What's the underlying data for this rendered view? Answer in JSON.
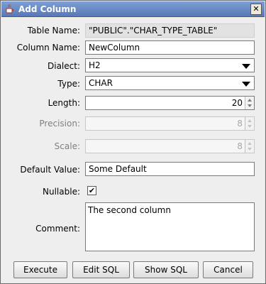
{
  "window": {
    "title": "Add Column",
    "icon": "java-cup-icon",
    "close_glyph": "✕"
  },
  "form": {
    "table_name": {
      "label": "Table Name:",
      "value": "\"PUBLIC\".\"CHAR_TYPE_TABLE\""
    },
    "column_name": {
      "label": "Column Name:",
      "value": "NewColumn"
    },
    "dialect": {
      "label": "Dialect:",
      "value": "H2"
    },
    "type": {
      "label": "Type:",
      "value": "CHAR"
    },
    "length": {
      "label": "Length:",
      "value": "20"
    },
    "precision": {
      "label": "Precision:",
      "value": "8"
    },
    "scale": {
      "label": "Scale:",
      "value": "8"
    },
    "default_value": {
      "label": "Default Value:",
      "value": "Some Default"
    },
    "nullable": {
      "label": "Nullable:",
      "checked": true,
      "glyph": "✔"
    },
    "comment": {
      "label": "Comment:",
      "value": "The second column"
    }
  },
  "buttons": {
    "execute": "Execute",
    "edit_sql": "Edit SQL",
    "show_sql": "Show SQL",
    "cancel": "Cancel"
  },
  "colors": {
    "title_bar": "#5878b8",
    "panel": "#eeeeee"
  }
}
